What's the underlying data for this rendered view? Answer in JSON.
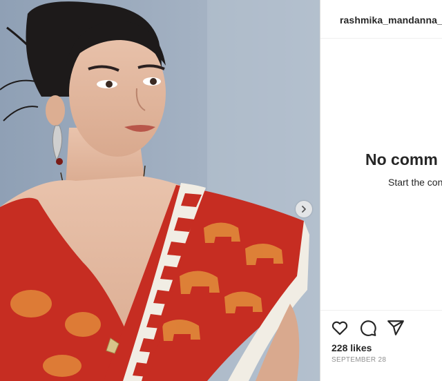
{
  "post": {
    "username": "rashmika_mandanna_ho",
    "image_alt": "Woman with hair tied back wearing a red and cream silk saree with elephant motifs",
    "next_icon": "chevron-right-icon"
  },
  "comments": {
    "empty_title": "No comm",
    "empty_subtitle": "Start the con"
  },
  "actions": {
    "like_icon": "heart-outline-icon",
    "comment_icon": "speech-bubble-icon",
    "share_icon": "paper-plane-icon"
  },
  "stats": {
    "likes_text": "228 likes",
    "date_text": "SEPTEMBER 28"
  },
  "colors": {
    "text_primary": "#262626",
    "text_secondary": "#8e8e8e",
    "border": "#efefef",
    "saree_red": "#c62d22",
    "saree_gold": "#e0893a",
    "saree_cream": "#f1ede4"
  }
}
